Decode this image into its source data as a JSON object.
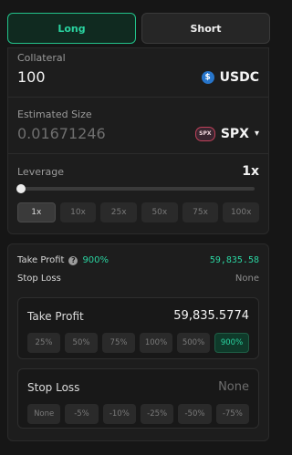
{
  "tabs": {
    "long": "Long",
    "short": "Short"
  },
  "collateral": {
    "label": "Collateral",
    "value": "100",
    "token": "USDC",
    "token_icon": "usdc-icon"
  },
  "estimated_size": {
    "label": "Estimated Size",
    "value": "0.01671246",
    "token": "SPX",
    "token_icon": "spx-icon",
    "token_icon_text": "SPX"
  },
  "leverage": {
    "label": "Leverage",
    "value": "1x",
    "slider_level_fraction": 0,
    "options": [
      "1x",
      "10x",
      "25x",
      "50x",
      "75x",
      "100x"
    ],
    "selected_index": 0
  },
  "summary": {
    "take_profit_label": "Take Profit",
    "take_profit_percent": "900%",
    "take_profit_value": "59,835.58",
    "stop_loss_label": "Stop Loss",
    "stop_loss_value": "None"
  },
  "take_profit_card": {
    "title": "Take Profit",
    "value": "59,835.5774",
    "options": [
      "25%",
      "50%",
      "75%",
      "100%",
      "500%",
      "900%"
    ],
    "selected_index": 5
  },
  "stop_loss_card": {
    "title": "Stop Loss",
    "value": "None",
    "options": [
      "None",
      "-5%",
      "-10%",
      "-25%",
      "-50%",
      "-75%"
    ]
  },
  "colors": {
    "accent_green": "#2ad3a0",
    "background": "#161616"
  }
}
